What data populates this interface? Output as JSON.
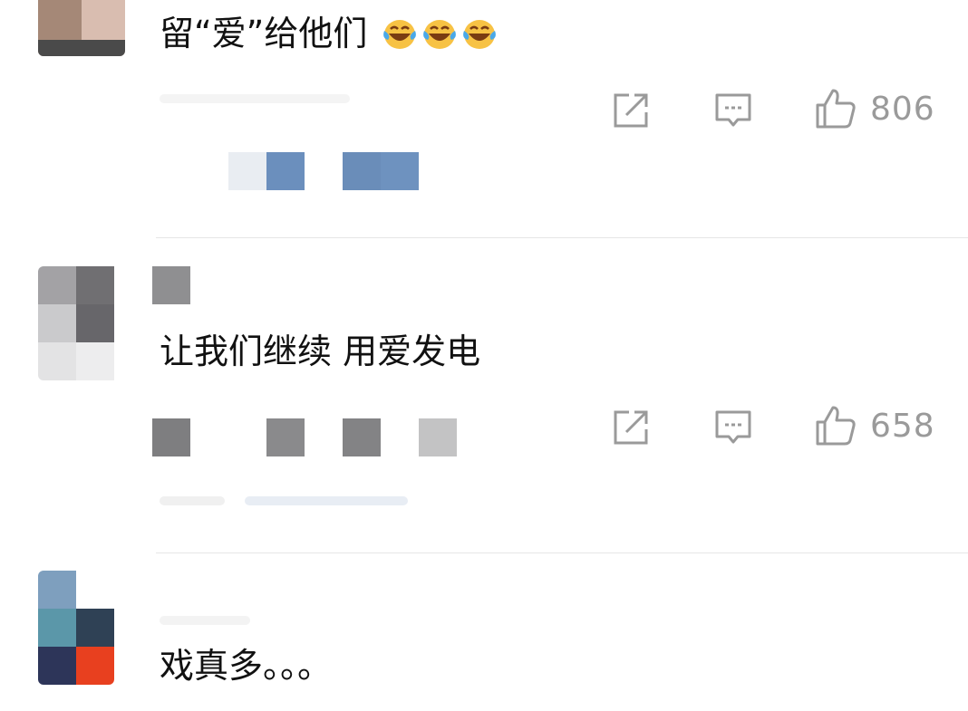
{
  "comments": [
    {
      "text": "留“爱”给他们",
      "emoji_icon": "laughing-tears-icon",
      "emoji_count": 3,
      "likes": "806"
    },
    {
      "text": "让我们继续 用爱发电",
      "likes": "658"
    },
    {
      "text": "戏真多。。。"
    }
  ],
  "icons": {
    "share": "share-icon",
    "reply": "comment-bubble-icon",
    "like": "thumbs-up-icon"
  },
  "colors": {
    "text": "#111111",
    "icon": "#9a9a9a",
    "divider": "#e6e6e6",
    "emoji_face": "#f7c244",
    "emoji_tear": "#4aa8e8"
  }
}
